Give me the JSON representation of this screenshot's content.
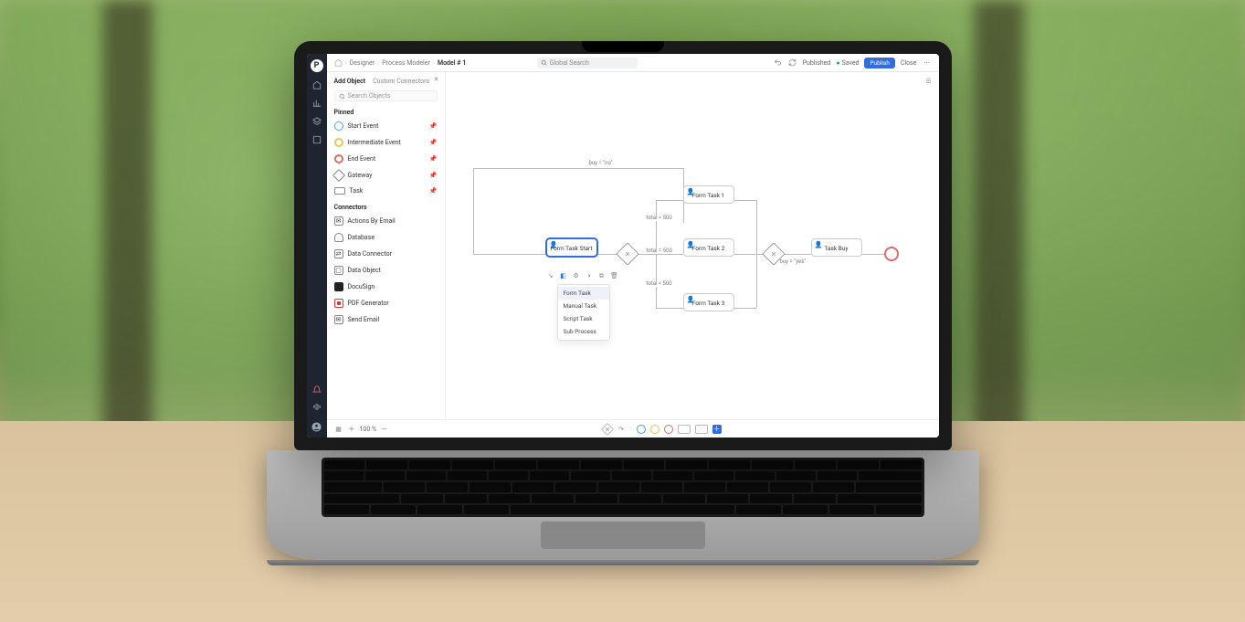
{
  "breadcrumbs": {
    "root": "Designer",
    "mid": "Process Modeler",
    "current": "Model # 1"
  },
  "search": {
    "placeholder": "Global Search"
  },
  "header": {
    "published": "Published",
    "saved": "Saved",
    "publish_btn": "Publish",
    "close": "Close"
  },
  "panel": {
    "tab_add": "Add Object",
    "tab_custom": "Custom Connectors",
    "search_placeholder": "Search Objects",
    "section_pinned": "Pinned",
    "pinned": [
      {
        "key": "start",
        "label": "Start Event"
      },
      {
        "key": "inter",
        "label": "Intermediate Event"
      },
      {
        "key": "end",
        "label": "End Event"
      },
      {
        "key": "gate",
        "label": "Gateway"
      },
      {
        "key": "task",
        "label": "Task"
      }
    ],
    "section_connectors": "Connectors",
    "connectors": [
      {
        "key": "email",
        "label": "Actions By Email"
      },
      {
        "key": "db",
        "label": "Database"
      },
      {
        "key": "dc",
        "label": "Data Connector"
      },
      {
        "key": "do",
        "label": "Data Object"
      },
      {
        "key": "ds",
        "label": "DocuSign"
      },
      {
        "key": "pdf",
        "label": "PDF Generator"
      },
      {
        "key": "send",
        "label": "Send Email"
      }
    ]
  },
  "context_menu": {
    "items": [
      "Form Task",
      "Manual Task",
      "Script Task",
      "Sub Process"
    ]
  },
  "nodes": {
    "start": "Form Task Start",
    "t1": "Form Task 1",
    "t2": "Form Task 2",
    "t3": "Form Task 3",
    "buy": "Task Buy"
  },
  "edges": {
    "buy_no": "buy = \"no\"",
    "total_gt": "total > 500",
    "total_eq": "total = 500",
    "total_lt": "total < 500",
    "buy_yes": "buy = \"yes\""
  },
  "zoom": {
    "value": "100 %"
  }
}
